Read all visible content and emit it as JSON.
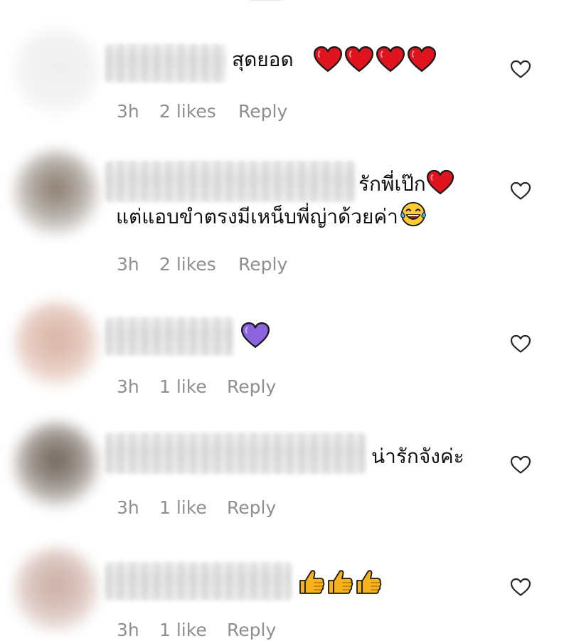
{
  "comments": [
    {
      "time": "3h",
      "likes": "2 likes",
      "reply": "Reply",
      "text_lines": [
        "สุดยอด"
      ],
      "emoji": [
        "red-heart",
        "red-heart",
        "red-heart",
        "red-heart"
      ]
    },
    {
      "time": "3h",
      "likes": "2 likes",
      "reply": "Reply",
      "text_lines": [
        "รักพี่เป๊ก",
        "แต่แอบขำตรงมีเหน็บพี่ญ่าด้วยค่า"
      ],
      "emoji": [
        "red-heart",
        "tears-of-joy-face"
      ]
    },
    {
      "time": "3h",
      "likes": "1 like",
      "reply": "Reply",
      "text_lines": [],
      "emoji": [
        "purple-heart"
      ]
    },
    {
      "time": "3h",
      "likes": "1 like",
      "reply": "Reply",
      "text_lines": [
        "น่ารักจังค่ะ"
      ],
      "emoji": []
    },
    {
      "time": "3h",
      "likes": "1 like",
      "reply": "Reply",
      "text_lines": [],
      "emoji": [
        "thumbs-up",
        "thumbs-up",
        "thumbs-up"
      ]
    }
  ],
  "colors": {
    "meta_text": "#8e8e8e",
    "comment_text": "#111111",
    "heart_red": "#e0141e",
    "heart_purple": "#8c64e0",
    "thumb_yellow": "#f5b21c",
    "like_icon": "#262626"
  }
}
